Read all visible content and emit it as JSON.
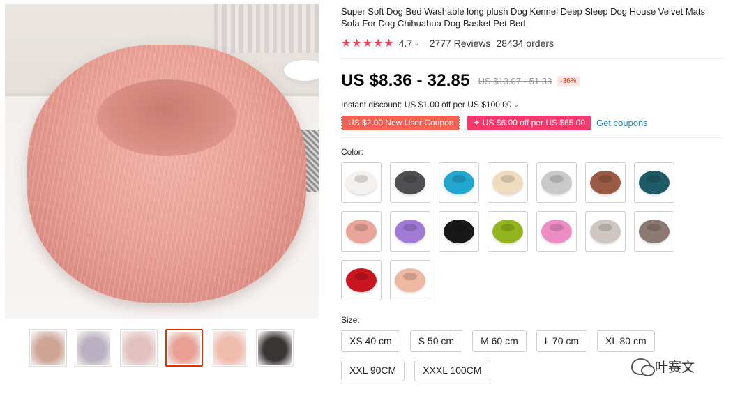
{
  "product": {
    "title": "Super Soft Dog Bed Washable long plush Dog Kennel Deep Sleep Dog House Velvet Mats Sofa For Dog Chihuahua Dog Basket Pet Bed",
    "stars": "★★★★★",
    "rating": "4.7",
    "reviews": "2777 Reviews",
    "orders": "28434 orders"
  },
  "pricing": {
    "price": "US $8.36 - 32.85",
    "original_price": "US $13.07 - 51.33",
    "discount": "-36%",
    "instant_discount": "Instant discount: US $1.00 off per US $100.00",
    "coupon_new_user": "US $2.00 New User Coupon",
    "coupon_store": "✦ US $6.00 off per US $65.00",
    "get_coupons": "Get coupons"
  },
  "color": {
    "label": "Color:",
    "swatches": [
      "#f4f1ef",
      "#4f4f52",
      "#21a6cf",
      "#efdcbf",
      "#c9c9cb",
      "#9b5a44",
      "#1f5b66",
      "#e9a59a",
      "#a17ad6",
      "#181818",
      "#92b41e",
      "#ec8ec5",
      "#cfc6c2",
      "#8c7a72",
      "#c9151f",
      "#efb8a3"
    ]
  },
  "size": {
    "label": "Size:",
    "options": [
      "XS 40 cm",
      "S 50 cm",
      "M 60 cm",
      "L 70 cm",
      "XL 80 cm",
      "XXL 90CM",
      "XXXL 100CM"
    ]
  },
  "gallery": {
    "thumb_colors": [
      "#cfa596",
      "#b9b1c2",
      "#e3c1bf",
      "#e9a196",
      "#f0bcae",
      "#3a3535"
    ],
    "active_index": 3
  },
  "watermark": "叶赛文",
  "colors": {
    "accent": "#e62e04",
    "star": "#f5465e",
    "link": "#2e86c1"
  }
}
